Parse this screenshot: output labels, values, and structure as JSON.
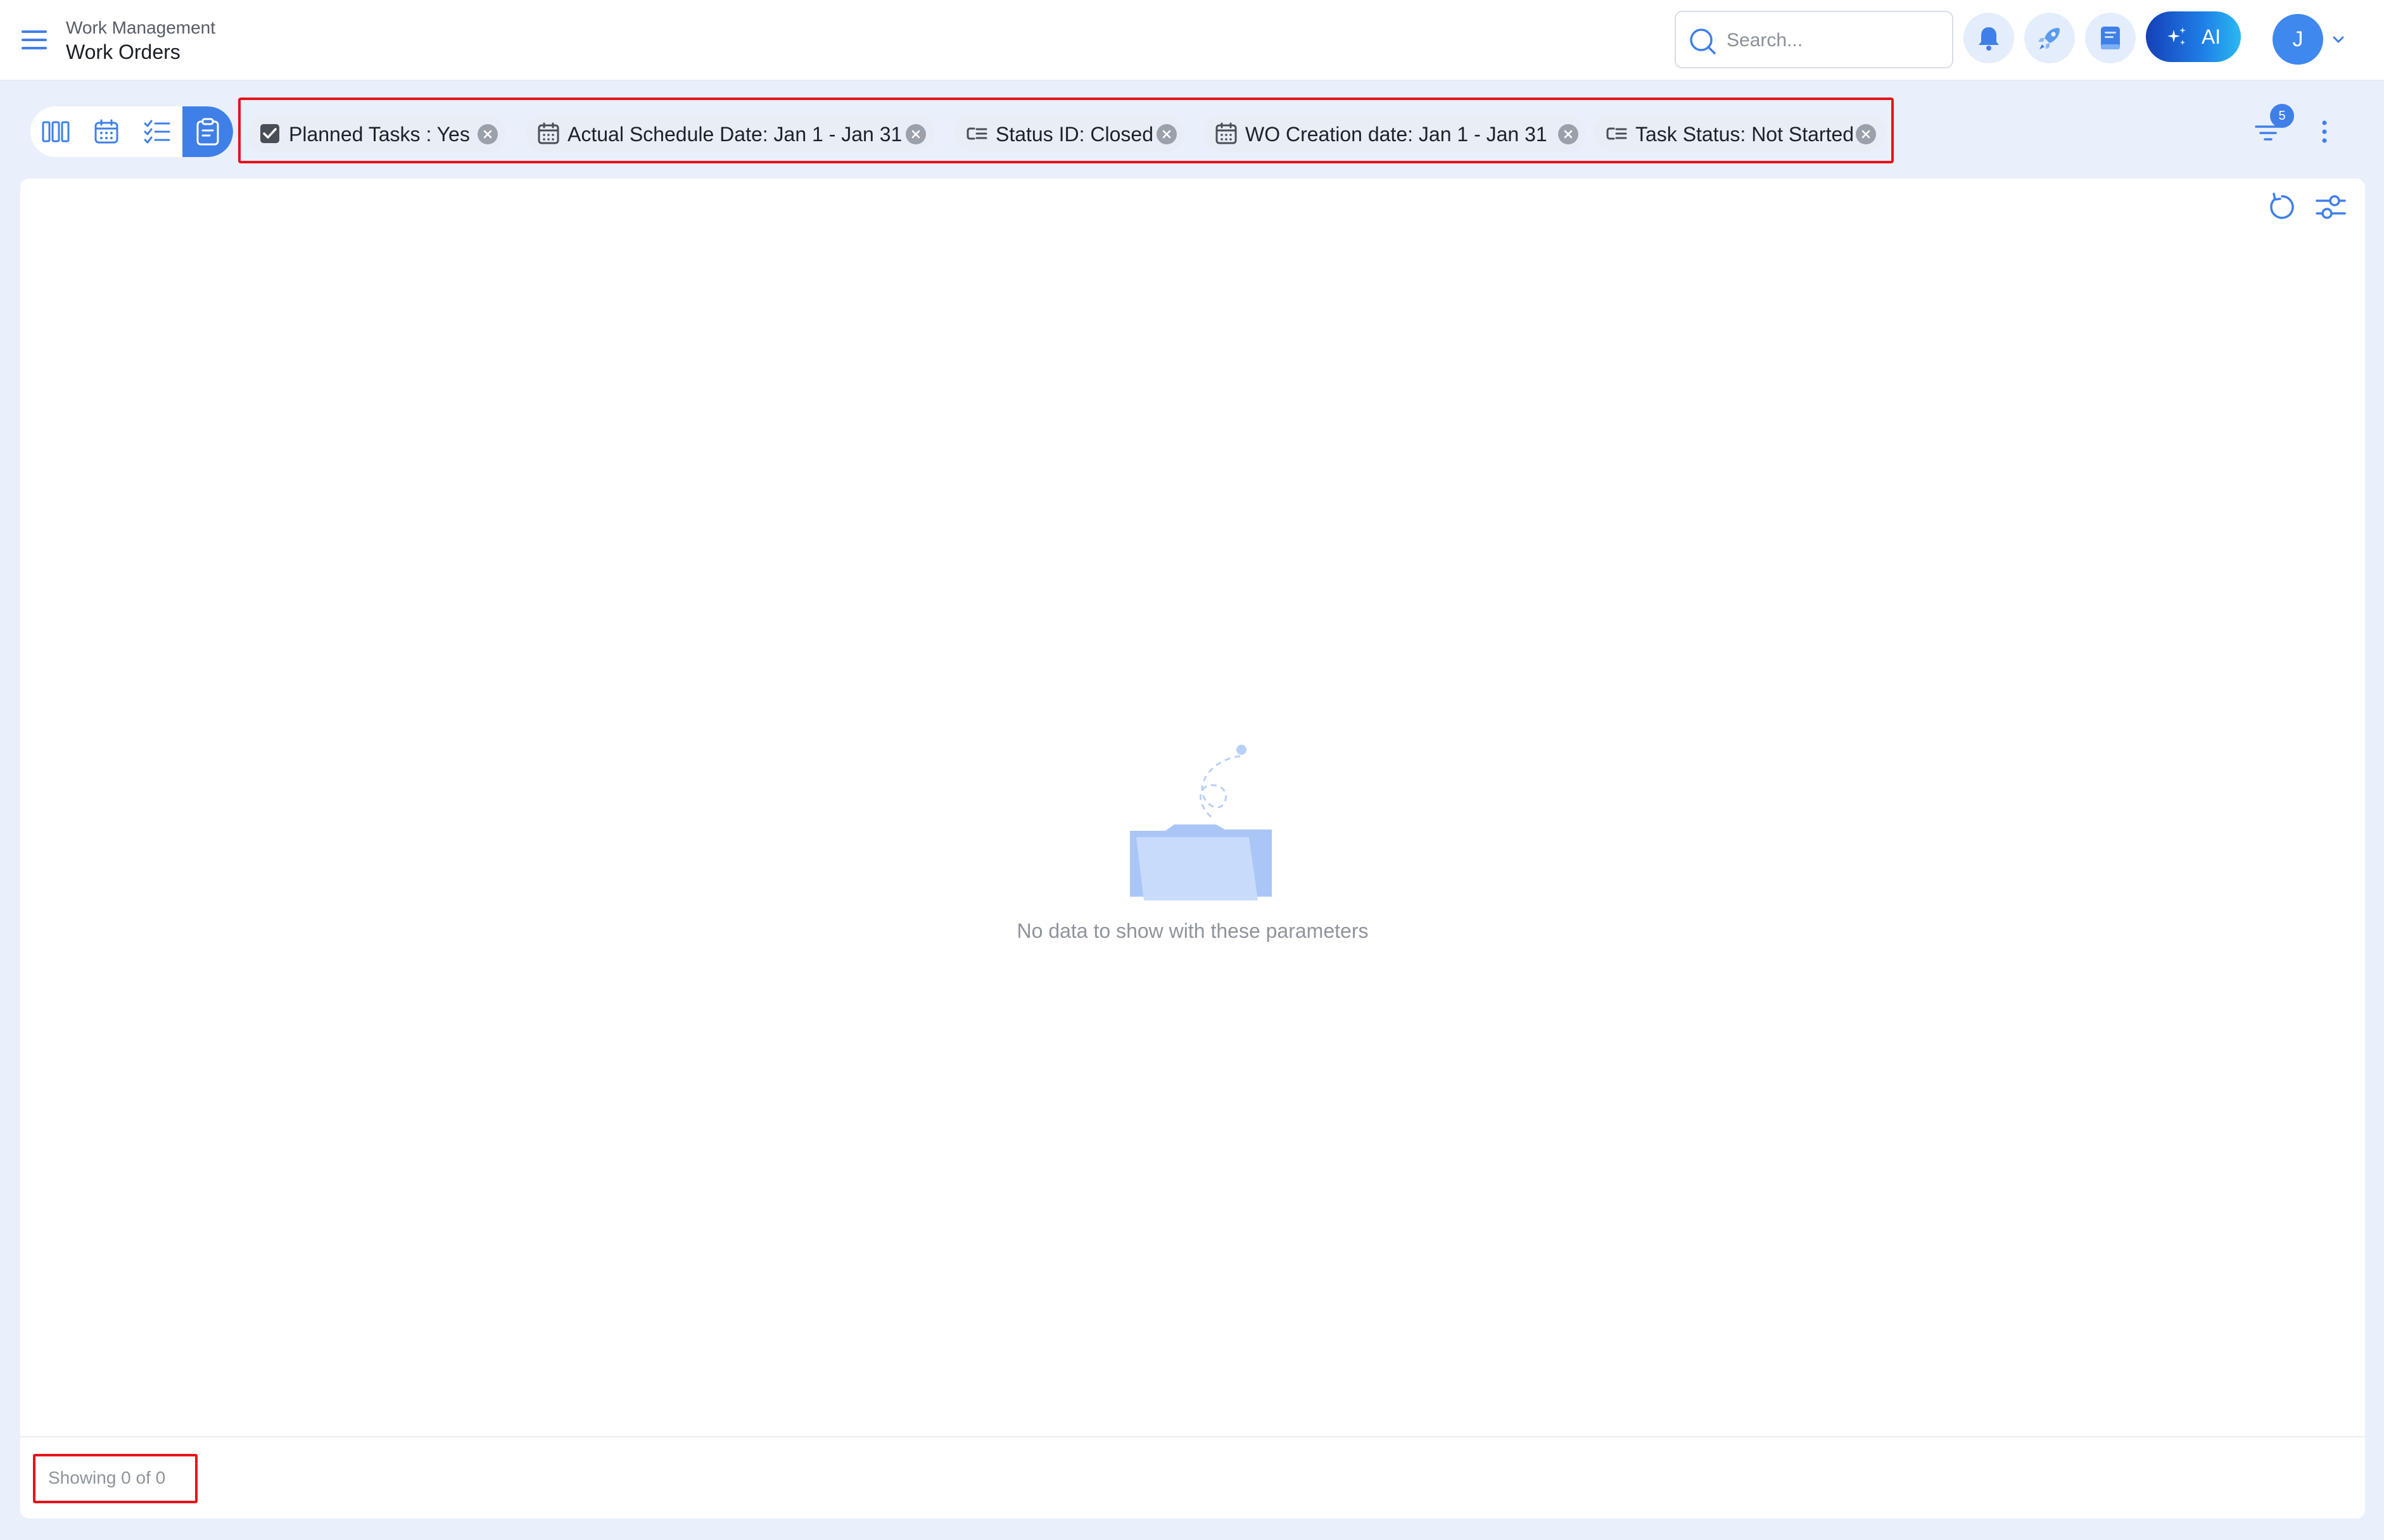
{
  "header": {
    "breadcrumb_parent": "Work Management",
    "title": "Work Orders",
    "search": {
      "placeholder": "Search...",
      "value": ""
    },
    "ai_label": "AI",
    "user_initial": "J"
  },
  "view_switch": {
    "items": [
      "board-view",
      "calendar-view",
      "checklist-view",
      "clipboard-view"
    ],
    "active": "clipboard-view"
  },
  "filters": [
    {
      "icon": "checkbox-icon",
      "label": "Planned Tasks : Yes"
    },
    {
      "icon": "calendar-icon",
      "label": "Actual Schedule Date: Jan 1 - Jan 31"
    },
    {
      "icon": "list-filter-icon",
      "label": "Status ID: Closed"
    },
    {
      "icon": "calendar-icon",
      "label": "WO Creation date: Jan 1 - Jan 31"
    },
    {
      "icon": "list-filter-icon",
      "label": "Task Status: Not Started"
    }
  ],
  "filter_count": "5",
  "main": {
    "empty_message": "No data to show with these parameters",
    "showing": "Showing 0 of 0"
  },
  "colors": {
    "accent": "#3f7fe8",
    "highlight": "#e8121b",
    "background": "#e9f0fb"
  }
}
